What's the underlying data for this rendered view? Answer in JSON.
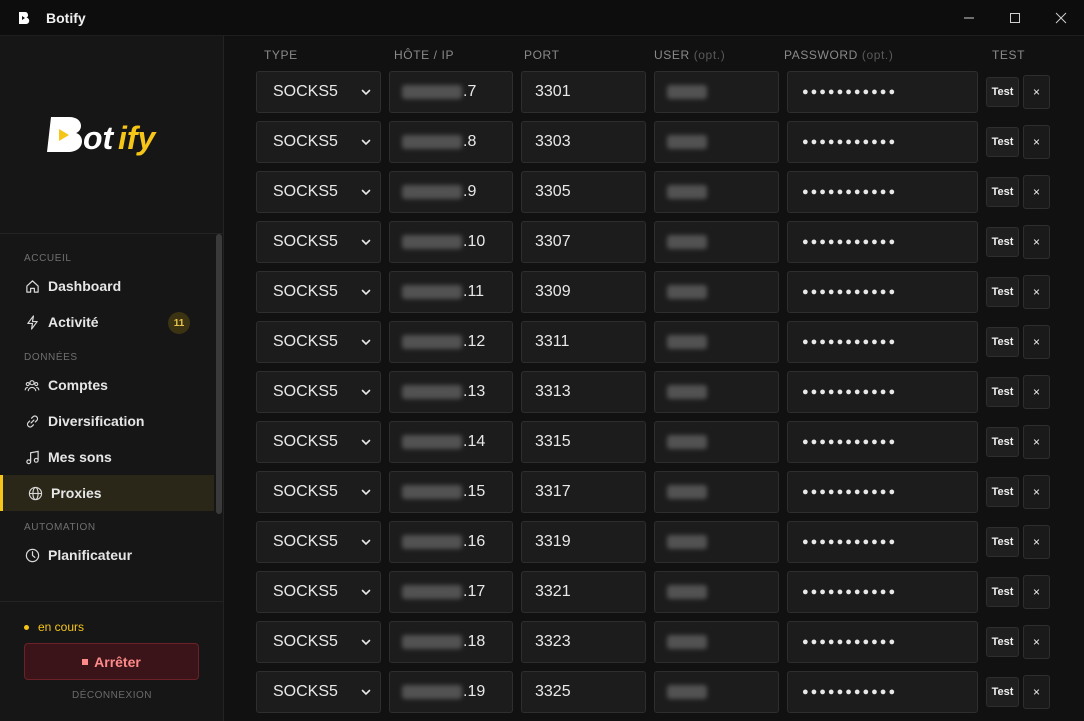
{
  "window": {
    "title": "Botify",
    "controls": {
      "minimize": "—",
      "maximize": "☐",
      "close": "✕"
    }
  },
  "colors": {
    "accent": "#f5c518",
    "danger": "#ff8a8a",
    "bg": "#111111",
    "sidebar": "#161616"
  },
  "sidebar": {
    "logo_text": "Botify",
    "sections": [
      {
        "label": "ACCUEIL"
      },
      {
        "label": "DONNÉES"
      },
      {
        "label": "AUTOMATION"
      }
    ],
    "items": [
      {
        "label": "Dashboard",
        "icon": "home-icon"
      },
      {
        "label": "Activité",
        "icon": "bolt-icon",
        "badge": "11"
      },
      {
        "label": "Comptes",
        "icon": "users-icon"
      },
      {
        "label": "Diversification",
        "icon": "link-icon"
      },
      {
        "label": "Mes sons",
        "icon": "music-note-icon"
      },
      {
        "label": "Proxies",
        "icon": "globe-icon",
        "active": true
      },
      {
        "label": "Planificateur",
        "icon": "clock-icon"
      }
    ],
    "footer": {
      "status": "en cours",
      "stop_button": "Arrêter",
      "logout": "DÉCONNEXION"
    }
  },
  "table": {
    "headers": {
      "type": "TYPE",
      "host": "HÔTE / IP",
      "port": "PORT",
      "user": "USER",
      "user_opt": "(opt.)",
      "password": "PASSWORD",
      "password_opt": "(opt.)",
      "test": "TEST"
    },
    "test_label": "Test",
    "delete_label": "×",
    "rows": [
      {
        "type": "SOCKS5",
        "host_suffix": ".7",
        "port": "3301",
        "password": "●●●●●●●●●●●"
      },
      {
        "type": "SOCKS5",
        "host_suffix": ".8",
        "port": "3303",
        "password": "●●●●●●●●●●●"
      },
      {
        "type": "SOCKS5",
        "host_suffix": ".9",
        "port": "3305",
        "password": "●●●●●●●●●●●"
      },
      {
        "type": "SOCKS5",
        "host_suffix": ".10",
        "port": "3307",
        "password": "●●●●●●●●●●●"
      },
      {
        "type": "SOCKS5",
        "host_suffix": ".11",
        "port": "3309",
        "password": "●●●●●●●●●●●"
      },
      {
        "type": "SOCKS5",
        "host_suffix": ".12",
        "port": "3311",
        "password": "●●●●●●●●●●●"
      },
      {
        "type": "SOCKS5",
        "host_suffix": ".13",
        "port": "3313",
        "password": "●●●●●●●●●●●"
      },
      {
        "type": "SOCKS5",
        "host_suffix": ".14",
        "port": "3315",
        "password": "●●●●●●●●●●●"
      },
      {
        "type": "SOCKS5",
        "host_suffix": ".15",
        "port": "3317",
        "password": "●●●●●●●●●●●"
      },
      {
        "type": "SOCKS5",
        "host_suffix": ".16",
        "port": "3319",
        "password": "●●●●●●●●●●●"
      },
      {
        "type": "SOCKS5",
        "host_suffix": ".17",
        "port": "3321",
        "password": "●●●●●●●●●●●"
      },
      {
        "type": "SOCKS5",
        "host_suffix": ".18",
        "port": "3323",
        "password": "●●●●●●●●●●●"
      },
      {
        "type": "SOCKS5",
        "host_suffix": ".19",
        "port": "3325",
        "password": "●●●●●●●●●●●"
      }
    ]
  }
}
